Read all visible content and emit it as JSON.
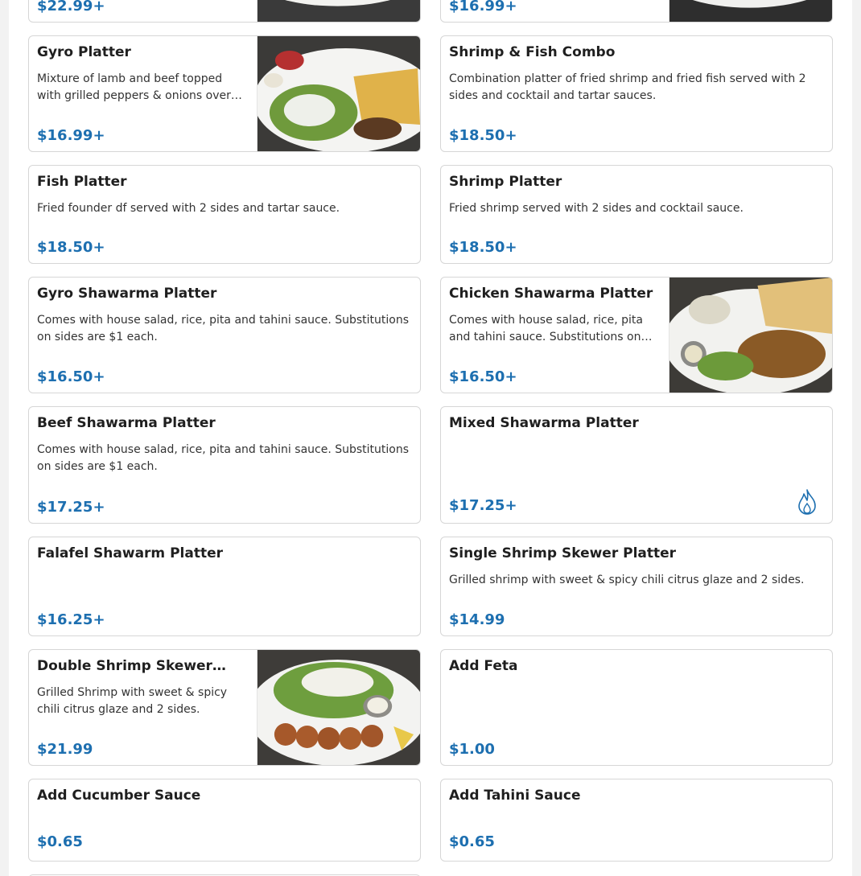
{
  "menu": {
    "items": [
      {
        "id": "top-left",
        "name": "",
        "desc": "",
        "price": "$22.99+",
        "image": "food-photo"
      },
      {
        "id": "top-right",
        "name": "",
        "desc": "",
        "price": "$16.99+",
        "image": "food-photo"
      },
      {
        "id": "gyro-platter",
        "name": "Gyro Platter",
        "desc": "Mixture of lamb and beef topped with grilled peppers & onions over…",
        "price": "$16.99+",
        "image": "gyro-platter-photo"
      },
      {
        "id": "shrimp-fish-combo",
        "name": "Shrimp & Fish Combo",
        "desc": "Combination platter of fried shrimp and fried fish served with 2 sides and cocktail and tartar sauces.",
        "price": "$18.50+",
        "image": ""
      },
      {
        "id": "fish-platter",
        "name": "Fish Platter",
        "desc": "Fried founder df served with 2 sides and tartar sauce.",
        "price": "$18.50+",
        "image": ""
      },
      {
        "id": "shrimp-platter",
        "name": "Shrimp Platter",
        "desc": "Fried shrimp served with 2 sides and cocktail sauce.",
        "price": "$18.50+",
        "image": ""
      },
      {
        "id": "gyro-shawarma-platter",
        "name": "Gyro Shawarma Platter",
        "desc": "Comes with house salad, rice, pita and tahini sauce. Substitutions on sides are $1 each.",
        "price": "$16.50+",
        "image": ""
      },
      {
        "id": "chicken-shawarma-platter",
        "name": "Chicken Shawarma Platter",
        "desc": "Comes with house salad, rice, pita and tahini sauce. Substitutions on…",
        "price": "$16.50+",
        "image": "chicken-shawarma-photo"
      },
      {
        "id": "beef-shawarma-platter",
        "name": "Beef Shawarma Platter",
        "desc": "Comes with house salad, rice, pita and tahini sauce. Substitutions on sides are $1 each.",
        "price": "$17.25+",
        "image": ""
      },
      {
        "id": "mixed-shawarma-platter",
        "name": "Mixed Shawarma Platter",
        "desc": "",
        "price": "$17.25+",
        "image": "",
        "badge": "flame-icon"
      },
      {
        "id": "falafel-shawarm-platter",
        "name": "Falafel Shawarm Platter",
        "desc": "",
        "price": "$16.25+",
        "image": ""
      },
      {
        "id": "single-shrimp-skewer-platter",
        "name": "Single Shrimp Skewer Platter",
        "desc": "Grilled shrimp with sweet & spicy chili citrus glaze and 2 sides.",
        "price": "$14.99",
        "image": ""
      },
      {
        "id": "double-shrimp-skewer",
        "name": "Double Shrimp Skewer…",
        "desc": "Grilled Shrimp with sweet & spicy chili citrus glaze and 2 sides.",
        "price": "$21.99",
        "image": "shrimp-skewer-photo"
      },
      {
        "id": "add-feta",
        "name": "Add Feta",
        "desc": "",
        "price": "$1.00",
        "image": ""
      },
      {
        "id": "add-cucumber-sauce",
        "name": "Add Cucumber Sauce",
        "desc": "",
        "price": "$0.65",
        "image": ""
      },
      {
        "id": "add-tahini-sauce",
        "name": "Add Tahini Sauce",
        "desc": "",
        "price": "$0.65",
        "image": ""
      }
    ]
  },
  "colors": {
    "price": "#1d6fb0",
    "border": "#d6d6d6",
    "accent": "#1d6fb0"
  }
}
